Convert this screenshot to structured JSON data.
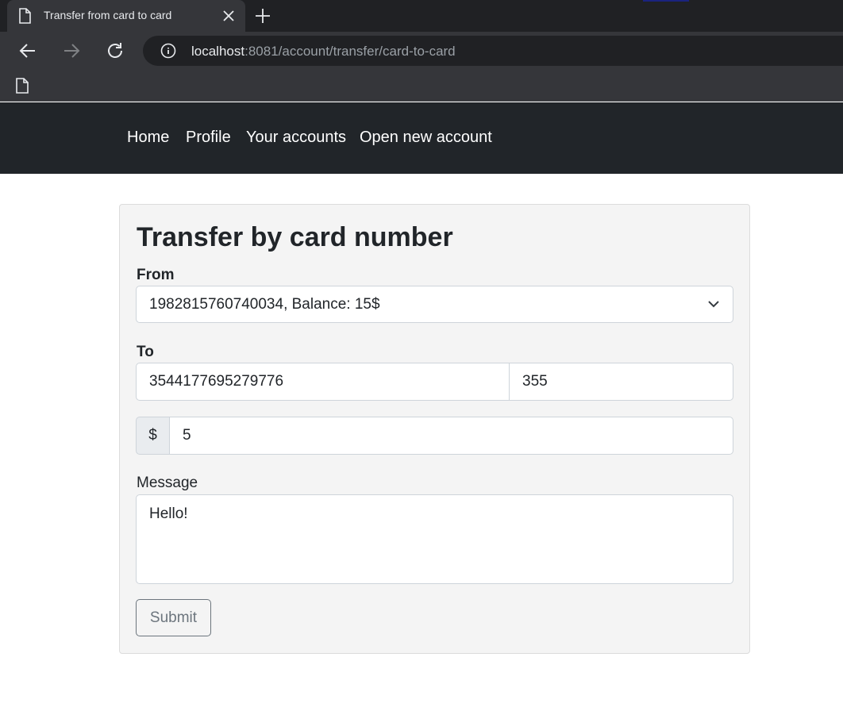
{
  "browser": {
    "tab_title": "Transfer from card to card",
    "url_host": "localhost",
    "url_rest": ":8081/account/transfer/card-to-card"
  },
  "nav": {
    "items": [
      "Home",
      "Profile",
      "Your accounts",
      "Open new account"
    ]
  },
  "form": {
    "title": "Transfer by card number",
    "from_label": "From",
    "from_value": "1982815760740034, Balance: 15$",
    "to_label": "To",
    "to_card_value": "3544177695279776",
    "to_cvv_value": "355",
    "currency_symbol": "$",
    "amount_value": "5",
    "message_label": "Message",
    "message_value": "Hello!",
    "submit_label": "Submit"
  },
  "colors": {
    "navbar": "#212529",
    "card_bg": "#f4f4f4",
    "submit_outline": "#6c757d"
  }
}
